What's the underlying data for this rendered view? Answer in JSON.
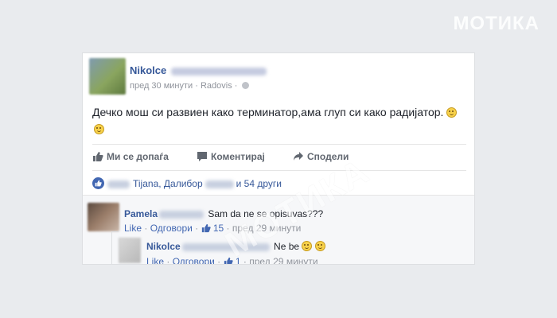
{
  "brand_watermark": "МОТИКА",
  "post": {
    "author": "Nikolce",
    "time": "пред 30 минути",
    "separator": "·",
    "location": "Radovis",
    "separator2": "·",
    "text": "Дечко мош си развиен како терминатор,ама глуп си како радијатор."
  },
  "actions": {
    "like": "Ми се допаѓа",
    "comment": "Коментирај",
    "share": "Сподели"
  },
  "likes_summary": {
    "names_visible": "Tijana, Далибор",
    "others": "и 54 други"
  },
  "comments": [
    {
      "author": "Pamela",
      "text": "Sam da ne se opisuvas???",
      "like_label": "Like",
      "reply_label": "Одговори",
      "like_count": "15",
      "time": "пред 29 минути"
    },
    {
      "author": "Nikolce",
      "text": "Ne be",
      "like_label": "Like",
      "reply_label": "Одговори",
      "like_count": "1",
      "time": "пред 29 минути"
    }
  ],
  "colors": {
    "link": "#365899",
    "meta": "#90949c",
    "text": "#1d2129",
    "like_blue": "#4267b2",
    "page_bg": "#e9ebee"
  }
}
